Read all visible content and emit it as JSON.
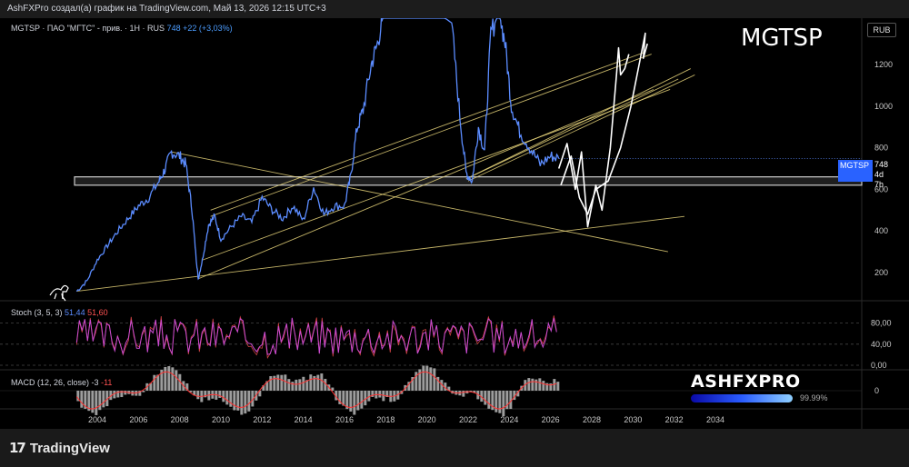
{
  "header": {
    "title": "AshFXPro создал(а) график на TradingView.com, Май 13, 2026 12:15 UTC+3"
  },
  "legend": {
    "symbol": "MGTSP · ПАО \"МГТС\" - прив. · 1Н · RUS",
    "last": "748",
    "change": "+22 (+3,03%)"
  },
  "big_ticker": "MGTSP",
  "currency": "RUB",
  "price_tag": {
    "symbol": "MGTSP",
    "value": "748",
    "countdown": "4d 7h"
  },
  "stoch": {
    "label": "Stoch (3, 5, 3)",
    "k": "51,44",
    "d": "51,60"
  },
  "macd": {
    "label": "MACD (12, 26, close)",
    "v1": "-3",
    "v2": "-11"
  },
  "brand": {
    "name": "ASHFXPRO",
    "percent": "99.99%",
    "percent_value": 99.99
  },
  "footer": {
    "logo_text": "TradingView"
  },
  "colors": {
    "price": "#5b8cff",
    "trend": "#e6d37a",
    "annotation": "#ffffff",
    "zone": "#cccccc",
    "stoch": "#c94bd1",
    "macd_hist": "#b8b8b8",
    "macd_line": "#ff3333"
  },
  "chart_data": {
    "type": "line",
    "title": "",
    "xlabel": "",
    "ylabel": "",
    "x_ticks": [
      "2004",
      "2006",
      "2008",
      "2010",
      "2012",
      "2014",
      "2016",
      "2018",
      "2020",
      "2022",
      "2024",
      "2026",
      "2028",
      "2030",
      "2032",
      "2034"
    ],
    "y_ticks": [
      200,
      400,
      600,
      800,
      1000,
      1200
    ],
    "ylim": [
      70,
      1450
    ],
    "xlim": [
      2002.2,
      2036.5
    ],
    "grid": false,
    "series": [
      {
        "points": [
          [
            2003.0,
            110
          ],
          [
            2003.5,
            160
          ],
          [
            2004.0,
            260
          ],
          [
            2004.5,
            330
          ],
          [
            2005.0,
            400
          ],
          [
            2005.5,
            460
          ],
          [
            2006.0,
            520
          ],
          [
            2006.5,
            560
          ],
          [
            2007.0,
            640
          ],
          [
            2007.3,
            700
          ],
          [
            2007.6,
            780
          ],
          [
            2008.0,
            760
          ],
          [
            2008.3,
            720
          ],
          [
            2008.6,
            500
          ],
          [
            2008.8,
            270
          ],
          [
            2008.9,
            170
          ],
          [
            2009.1,
            260
          ],
          [
            2009.4,
            430
          ],
          [
            2009.7,
            470
          ],
          [
            2010.0,
            360
          ],
          [
            2010.5,
            420
          ],
          [
            2011.0,
            470
          ],
          [
            2011.5,
            440
          ],
          [
            2012.0,
            560
          ],
          [
            2012.5,
            500
          ],
          [
            2013.0,
            460
          ],
          [
            2013.5,
            520
          ],
          [
            2014.0,
            450
          ],
          [
            2014.5,
            610
          ],
          [
            2015.0,
            480
          ],
          [
            2015.5,
            520
          ],
          [
            2016.0,
            520
          ],
          [
            2016.3,
            660
          ],
          [
            2016.6,
            890
          ],
          [
            2016.9,
            980
          ],
          [
            2017.3,
            1200
          ],
          [
            2017.6,
            1300
          ],
          [
            2017.9,
            1450
          ],
          [
            2018.3,
            1450
          ],
          [
            2019.5,
            1450
          ],
          [
            2020.5,
            1450
          ],
          [
            2021.2,
            1400
          ],
          [
            2021.6,
            950
          ],
          [
            2021.9,
            680
          ],
          [
            2022.2,
            640
          ],
          [
            2022.5,
            900
          ],
          [
            2022.8,
            780
          ],
          [
            2023.1,
            1350
          ],
          [
            2023.5,
            1450
          ],
          [
            2023.8,
            1300
          ],
          [
            2024.1,
            1000
          ],
          [
            2024.5,
            880
          ],
          [
            2025.0,
            800
          ],
          [
            2025.5,
            720
          ],
          [
            2026.0,
            760
          ],
          [
            2026.4,
            748
          ]
        ]
      }
    ]
  }
}
